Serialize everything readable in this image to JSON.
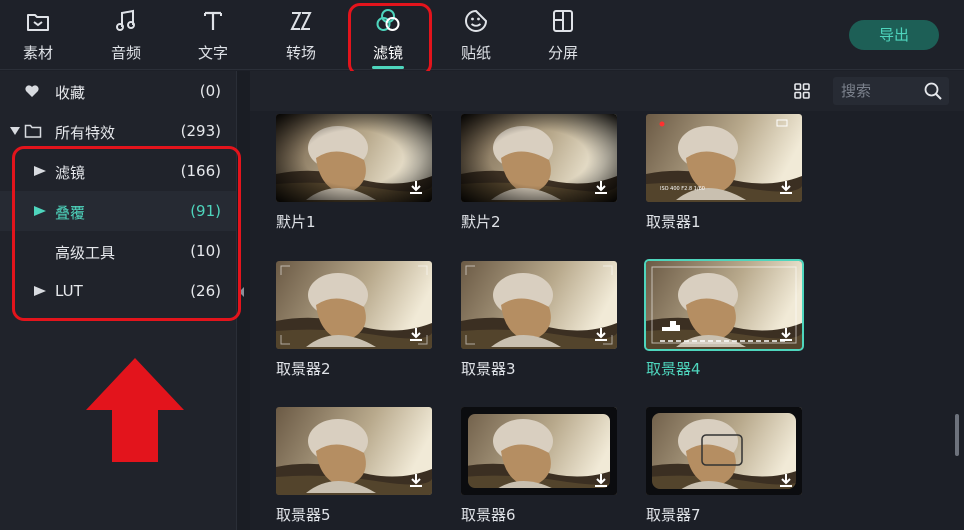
{
  "toolbar": {
    "tabs": [
      {
        "id": "media",
        "label": "素材",
        "icon": "folder-icon"
      },
      {
        "id": "audio",
        "label": "音频",
        "icon": "music-note-icon"
      },
      {
        "id": "text",
        "label": "文字",
        "icon": "text-icon"
      },
      {
        "id": "transition",
        "label": "转场",
        "icon": "transition-icon"
      },
      {
        "id": "filters",
        "label": "滤镜",
        "icon": "filter-circles-icon",
        "active": true
      },
      {
        "id": "stickers",
        "label": "贴纸",
        "icon": "sticker-smiley-icon"
      },
      {
        "id": "split",
        "label": "分屏",
        "icon": "split-screen-icon"
      }
    ],
    "export_label": "导出"
  },
  "sidebar": {
    "favorites": {
      "label": "收藏",
      "count": "(0)",
      "icon": "heart-icon"
    },
    "all_effects": {
      "label": "所有特效",
      "count": "(293)",
      "icon": "folder-icon"
    },
    "categories": [
      {
        "label": "滤镜",
        "count": "(166)"
      },
      {
        "label": "叠覆",
        "count": "(91)",
        "selected": true
      },
      {
        "label": "高级工具",
        "count": "(10)"
      },
      {
        "label": "LUT",
        "count": "(26)"
      }
    ]
  },
  "content": {
    "search_placeholder": "搜索",
    "grid_icon": "grid-view-icon",
    "items": [
      {
        "label": "默片1"
      },
      {
        "label": "默片2"
      },
      {
        "label": "取景器1"
      },
      {
        "label": "取景器2"
      },
      {
        "label": "取景器3"
      },
      {
        "label": "取景器4",
        "selected": true
      },
      {
        "label": "取景器5"
      },
      {
        "label": "取景器6"
      },
      {
        "label": "取景器7"
      }
    ]
  },
  "colors": {
    "accent": "#4ed5bd",
    "annotation_red": "#e3141c",
    "background": "#1d2028"
  }
}
